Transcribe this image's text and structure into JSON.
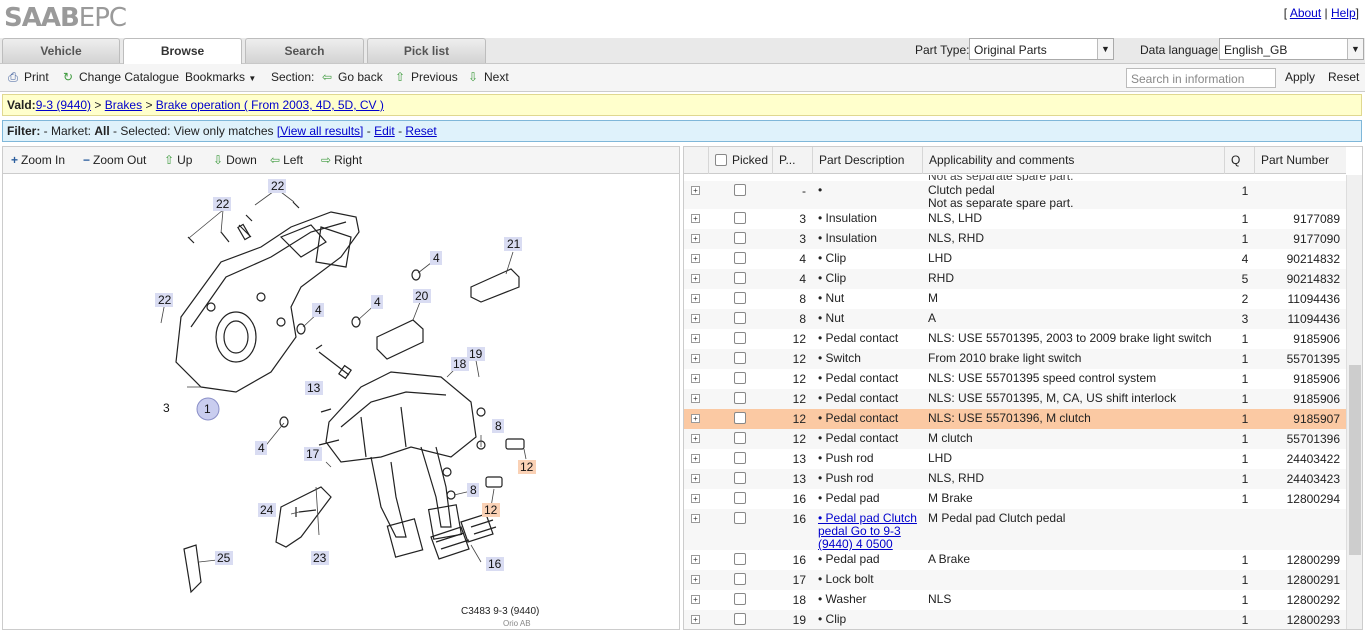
{
  "app": {
    "logo_bold": "SAAB",
    "logo_light": "EPC"
  },
  "toplinks": {
    "about": "About",
    "help": "Help"
  },
  "tabs": [
    {
      "label": "Vehicle"
    },
    {
      "label": "Browse"
    },
    {
      "label": "Search"
    },
    {
      "label": "Pick list"
    }
  ],
  "part_type": {
    "label": "Part Type:",
    "value": "Original Parts"
  },
  "data_language": {
    "label": "Data language:",
    "value": "English_GB"
  },
  "toolbar": {
    "print": "Print",
    "change_catalogue": "Change Catalogue",
    "bookmarks": "Bookmarks",
    "section": "Section:",
    "go_back": "Go back",
    "previous": "Previous",
    "next": "Next",
    "search_placeholder": "Search in information",
    "apply": "Apply",
    "reset": "Reset"
  },
  "vald": {
    "label": "Vald:",
    "model": "9-3 (9440)",
    "sep1": " > ",
    "brakes": "Brakes",
    "sep2": " > ",
    "operation": "Brake operation ( From 2003, 4D, 5D, CV )"
  },
  "filter": {
    "label": "Filter:",
    "market_text": " - Market: ",
    "market": "All",
    "selected_text": " - Selected: ",
    "selected": "View only matches ",
    "view_all": "[View all results]",
    "sep": " - ",
    "edit": "Edit",
    "reset": "Reset"
  },
  "viewer": {
    "zoom_in": "Zoom In",
    "zoom_out": "Zoom Out",
    "up": "Up",
    "down": "Down",
    "left": "Left",
    "right": "Right",
    "caption": "C3483 9-3 (9440)",
    "copyright": "Orio AB"
  },
  "table": {
    "headers": {
      "picked": "Picked",
      "pos": "P...",
      "desc": "Part Description",
      "applic": "Applicability and comments",
      "qty": "Q",
      "partno": "Part Number"
    },
    "top_partial": "Not as separate spare part.",
    "rows": [
      {
        "pos": "-",
        "desc": "•",
        "applic": "Clutch pedal",
        "applic2": "Not as separate spare part.",
        "qty": "1",
        "partno": ""
      },
      {
        "pos": "3",
        "desc": "• Insulation",
        "applic": "NLS, LHD",
        "qty": "1",
        "partno": "9177089"
      },
      {
        "pos": "3",
        "desc": "• Insulation",
        "applic": "NLS, RHD",
        "qty": "1",
        "partno": "9177090"
      },
      {
        "pos": "4",
        "desc": "• Clip",
        "applic": "LHD",
        "qty": "4",
        "partno": "90214832"
      },
      {
        "pos": "4",
        "desc": "• Clip",
        "applic": "RHD",
        "qty": "5",
        "partno": "90214832"
      },
      {
        "pos": "8",
        "desc": "• Nut",
        "applic": "M",
        "qty": "2",
        "partno": "11094436"
      },
      {
        "pos": "8",
        "desc": "• Nut",
        "applic": "A",
        "qty": "3",
        "partno": "11094436"
      },
      {
        "pos": "12",
        "desc": "• Pedal contact",
        "applic": "NLS: USE 55701395, 2003 to 2009 brake light switch",
        "qty": "1",
        "partno": "9185906"
      },
      {
        "pos": "12",
        "desc": "• Switch",
        "applic": "From 2010 brake light switch",
        "qty": "1",
        "partno": "55701395"
      },
      {
        "pos": "12",
        "desc": "• Pedal contact",
        "applic": "NLS: USE 55701395 speed control system",
        "qty": "1",
        "partno": "9185906"
      },
      {
        "pos": "12",
        "desc": "• Pedal contact",
        "applic": "NLS: USE 55701395, M, CA, US shift interlock",
        "qty": "1",
        "partno": "9185906"
      },
      {
        "pos": "12",
        "desc": "• Pedal contact",
        "applic": "NLS: USE 55701396, M clutch",
        "qty": "1",
        "partno": "9185907"
      },
      {
        "pos": "12",
        "desc": "• Pedal contact",
        "applic": "M clutch",
        "qty": "1",
        "partno": "55701396"
      },
      {
        "pos": "13",
        "desc": "• Push rod",
        "applic": "LHD",
        "qty": "1",
        "partno": "24403422"
      },
      {
        "pos": "13",
        "desc": "• Push rod",
        "applic": "NLS, RHD",
        "qty": "1",
        "partno": "24403423"
      },
      {
        "pos": "16",
        "desc": "• Pedal pad",
        "applic": "M Brake",
        "qty": "1",
        "partno": "12800294"
      },
      {
        "pos": "16",
        "desc_link1": "• Pedal pad Clutch",
        "desc_link2": "pedal Go to 9-3",
        "desc_link3": "(9440)  4  0500",
        "applic": "M Pedal pad Clutch pedal",
        "qty": "",
        "partno": ""
      },
      {
        "pos": "16",
        "desc": "• Pedal pad",
        "applic": "A Brake",
        "qty": "1",
        "partno": "12800299"
      },
      {
        "pos": "17",
        "desc": "• Lock bolt",
        "applic": "",
        "qty": "1",
        "partno": "12800291"
      },
      {
        "pos": "18",
        "desc": "• Washer",
        "applic": "NLS",
        "qty": "1",
        "partno": "12800292"
      },
      {
        "pos": "19",
        "desc": "• Clip",
        "applic": "",
        "qty": "1",
        "partno": "12800293"
      }
    ]
  },
  "diagram_labels": {
    "l1": "1",
    "l3": "3",
    "l4": "4",
    "l8": "8",
    "l12": "12",
    "l13": "13",
    "l16": "16",
    "l17": "17",
    "l18": "18",
    "l19": "19",
    "l20": "20",
    "l21": "21",
    "l22": "22",
    "l23": "23",
    "l24": "24",
    "l25": "25"
  }
}
